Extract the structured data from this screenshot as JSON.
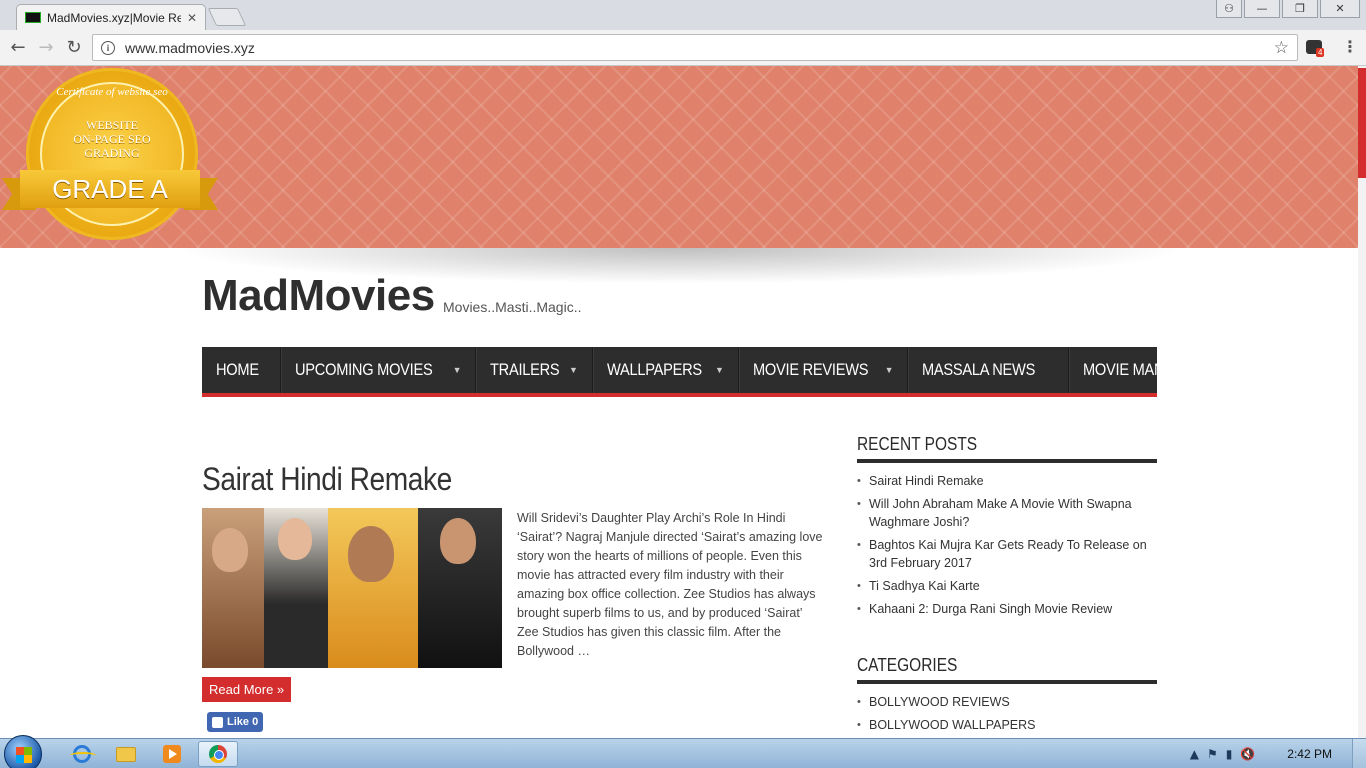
{
  "browser": {
    "tab_title": "MadMovies.xyz|Movie Re",
    "tab_close": "✕",
    "url": "www.madmovies.xyz",
    "extension_badge": "4"
  },
  "window_buttons": [
    "user",
    "minimize",
    "restore",
    "close"
  ],
  "banner": {
    "badge_arc": "Certificate of website seo",
    "badge_lines": [
      "WEBSITE",
      "ON-PAGE SEO",
      "GRADING"
    ],
    "badge_grade": "GRADE A"
  },
  "site": {
    "title": "MadMovies",
    "tagline": "Movies..Masti..Magic.."
  },
  "nav": [
    {
      "label": "HOME",
      "dropdown": false
    },
    {
      "label": "UPCOMING MOVIES",
      "dropdown": true
    },
    {
      "label": "TRAILERS",
      "dropdown": true
    },
    {
      "label": "WALLPAPERS",
      "dropdown": true
    },
    {
      "label": "MOVIE REVIEWS",
      "dropdown": true
    },
    {
      "label": "MASSALA NEWS",
      "dropdown": false
    },
    {
      "label": "MOVIE MANIA",
      "dropdown": false
    }
  ],
  "post": {
    "title": "Sairat Hindi Remake",
    "excerpt": "Will Sridevi’s Daughter Play Archi’s Role In Hindi ‘Sairat’? Nagraj Manjule directed ‘Sairat’s amazing love story won the hearts of millions of people.  Even this movie has attracted every film industry with their amazing box office collection. Zee Studios has always brought superb films to us, and by produced ‘Sairat’ Zee Studios has given this classic film. After the Bollywood …",
    "read_more": "Read More »",
    "fb_like": "Like 0"
  },
  "sidebar": {
    "recent_title": "RECENT POSTS",
    "recent_posts": [
      "Sairat Hindi Remake",
      "Will John Abraham Make A Movie With Swapna Waghmare Joshi?",
      "Baghtos Kai Mujra Kar Gets Ready To Release on 3rd February 2017",
      "Ti Sadhya Kai Karte",
      "Kahaani 2: Durga Rani Singh Movie Review"
    ],
    "categories_title": "CATEGORIES",
    "categories": [
      "BOLLYWOOD REVIEWS",
      "BOLLYWOOD WALLPAPERS"
    ]
  },
  "taskbar": {
    "clock": "2:42 PM"
  },
  "colors": {
    "accent": "#d32d2d",
    "nav_bg": "#2d2d2d",
    "banner": "#e0826b"
  }
}
